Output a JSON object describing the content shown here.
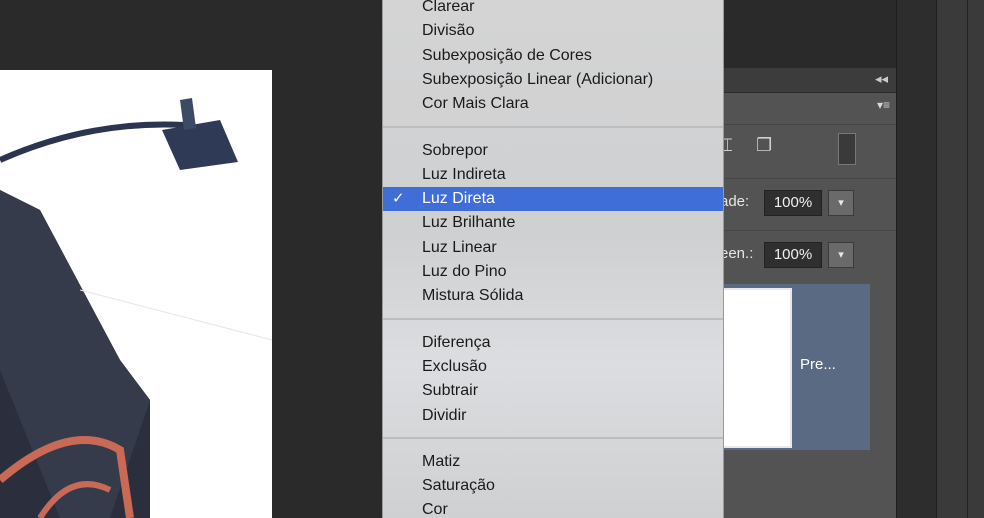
{
  "blend_menu": {
    "groups": [
      [
        "Clarear",
        "Divisão",
        "Subexposição de Cores",
        "Subexposição Linear (Adicionar)",
        "Cor Mais Clara"
      ],
      [
        "Sobrepor",
        "Luz Indireta",
        "Luz Direta",
        "Luz Brilhante",
        "Luz Linear",
        "Luz do Pino",
        "Mistura Sólida"
      ],
      [
        "Diferença",
        "Exclusão",
        "Subtrair",
        "Dividir"
      ],
      [
        "Matiz",
        "Saturação",
        "Cor"
      ]
    ],
    "selected": "Luz Direta",
    "checkmark": "✓"
  },
  "layers_panel": {
    "collapse_glyph": "◂◂",
    "menu_glyph": "▾≡",
    "opacity": {
      "label": "ade:",
      "value": "100%",
      "drop": "▾"
    },
    "fill": {
      "label": "een.:",
      "value": "100%",
      "drop": "▾"
    },
    "layer_name": "Pre..."
  },
  "colors": {
    "selection": "#3f6ed8",
    "layer_highlight": "#5a6a82"
  }
}
